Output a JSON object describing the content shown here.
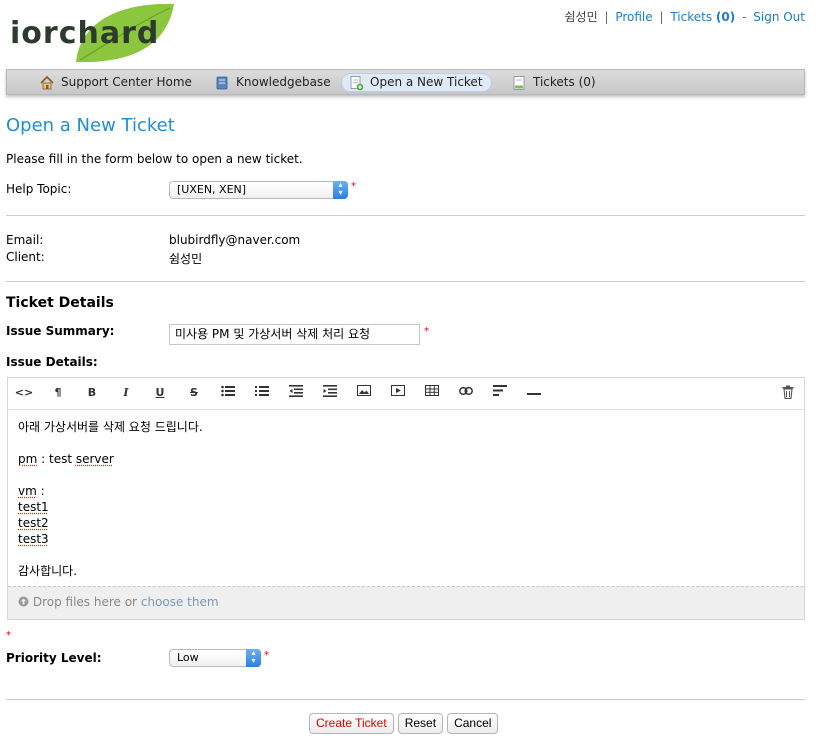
{
  "logo": {
    "text": "iorchard"
  },
  "topnav": {
    "user": "쉼성민",
    "profile": "Profile",
    "tickets_label": "Tickets",
    "tickets_count": "(0)",
    "signout": "Sign Out",
    "separator": "|",
    "dash": "-"
  },
  "nav": [
    {
      "label": "Support Center Home",
      "icon": "home-icon"
    },
    {
      "label": "Knowledgebase",
      "icon": "book-icon"
    },
    {
      "label": "Open a New Ticket",
      "icon": "new-ticket-icon",
      "active": true
    },
    {
      "label": "Tickets (0)",
      "icon": "tickets-icon"
    }
  ],
  "page": {
    "title": "Open a New Ticket",
    "intro": "Please fill in the form below to open a new ticket."
  },
  "form": {
    "help_topic_label": "Help Topic:",
    "help_topic_value": "[UXEN, XEN]",
    "required_mark": "*",
    "email_label": "Email:",
    "email_value": "blubirdfly@naver.com",
    "client_label": "Client:",
    "client_value": "쉼성민",
    "section_title": "Ticket Details",
    "summary_label": "Issue Summary:",
    "summary_value": "미사용 PM 및 가상서버 삭제 처리 요청",
    "details_label": "Issue Details:",
    "priority_label": "Priority Level:",
    "priority_value": "Low"
  },
  "editor": {
    "toolbar": [
      "code-view-icon",
      "paragraph-icon",
      "bold-icon",
      "italic-icon",
      "underline-icon",
      "strikethrough-icon",
      "unordered-list-icon",
      "ordered-list-icon",
      "outdent-icon",
      "indent-icon",
      "image-icon",
      "video-icon",
      "table-icon",
      "link-icon",
      "align-icon",
      "horizontal-rule-icon",
      "trash-icon"
    ],
    "lines": {
      "l1": "아래 가상서버를 삭제 요청 드립니다.",
      "pm_a": "pm",
      "pm_b": " : ",
      "pm_c": "test",
      "pm_d": " ",
      "pm_e": "server",
      "vm": "vm",
      "vm_colon": " :",
      "t1": "test1",
      "t2": "test2",
      "t3": "test3",
      "thanks": "감사합니다."
    },
    "dropzone_text": "Drop files here or ",
    "dropzone_link": "choose them"
  },
  "buttons": {
    "create": "Create Ticket",
    "reset": "Reset",
    "cancel": "Cancel"
  },
  "colors": {
    "accent": "#1e8fd6",
    "link": "#1e7bc4",
    "required": "#dd0000",
    "leaf": "#8cc63f"
  }
}
